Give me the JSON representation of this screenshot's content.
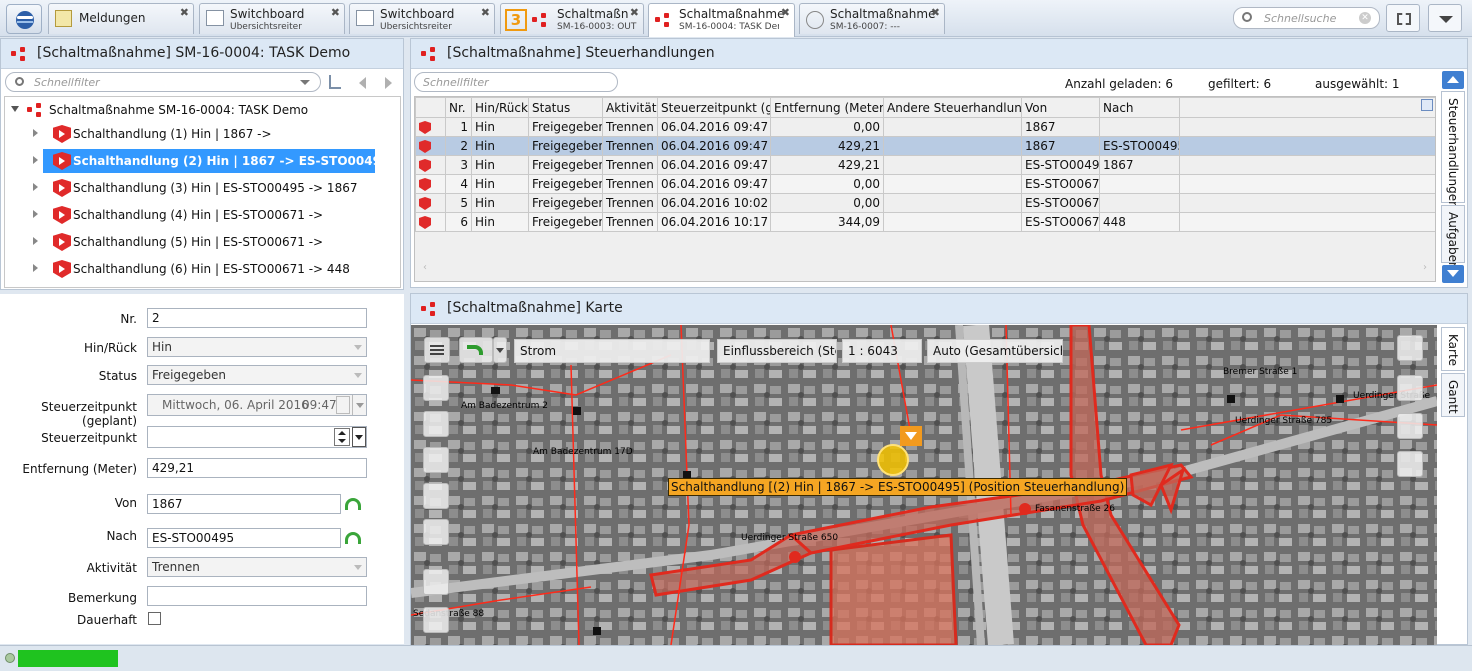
{
  "tabs": [
    {
      "title": "Meldungen",
      "subtitle": ""
    },
    {
      "title": "Switchboard",
      "subtitle": "Übersichtsreiter"
    },
    {
      "title": "Switchboard",
      "subtitle": "Übersichtsreiter"
    },
    {
      "title": "Schaltmaßnah",
      "subtitle": "SM-16-0003: OUT"
    },
    {
      "title": "Schaltmaßnahme",
      "subtitle": "SM-16-0004: TASK Demo"
    },
    {
      "title": "Schaltmaßnahme",
      "subtitle": "SM-16-0007: ---"
    }
  ],
  "tab_badge": "3",
  "search_placeholder": "Schnellsuche",
  "left_panel": {
    "title": "[Schaltmaßnahme] SM-16-0004: TASK Demo",
    "filter_placeholder": "Schnellfilter"
  },
  "tree": {
    "root": "Schaltmaßnahme SM-16-0004: TASK Demo",
    "items": [
      "Schalthandlung (1) Hin | 1867 ->",
      "Schalthandlung (2) Hin | 1867 -> ES-STO00495",
      "Schalthandlung (3) Hin | ES-STO00495 -> 1867",
      "Schalthandlung (4) Hin | ES-STO00671 ->",
      "Schalthandlung (5) Hin | ES-STO00671 ->",
      "Schalthandlung (6) Hin | ES-STO00671 -> 448"
    ]
  },
  "form": {
    "nr_label": "Nr.",
    "nr": "2",
    "hinrueck_label": "Hin/Rück",
    "hinrueck": "Hin",
    "status_label": "Status",
    "status": "Freigegeben",
    "geplant_label": "Steuerzeitpunkt (geplant)",
    "geplant_date": "Mittwoch, 06. April 2016",
    "geplant_time": "09:47",
    "steuerzeit_label": "Steuerzeitpunkt",
    "steuerzeit": "",
    "entfernung_label": "Entfernung (Meter)",
    "entfernung": "429,21",
    "von_label": "Von",
    "von": "1867",
    "nach_label": "Nach",
    "nach": "ES-STO00495",
    "aktivitaet_label": "Aktivität",
    "aktivitaet": "Trennen",
    "bemerkung_label": "Bemerkung",
    "bemerkung": "",
    "dauerhaft_label": "Dauerhaft"
  },
  "grid_panel": {
    "title": "[Schaltmaßnahme] Steuerhandlungen",
    "filter_placeholder": "Schnellfilter",
    "geladen": "Anzahl geladen: 6",
    "gefiltert": "gefiltert: 6",
    "ausgewaehlt": "ausgewählt: 1",
    "columns": [
      "",
      "Nr.",
      "Hin/Rück",
      "Status",
      "Aktivität",
      "Steuerzeitpunkt (ge",
      "Entfernung (Meter)",
      "Andere Steuerhandlung",
      "Von",
      "Nach"
    ],
    "rows": [
      [
        "1",
        "Hin",
        "Freigegeben",
        "Trennen",
        "06.04.2016 09:47",
        "0,00",
        "",
        "1867",
        ""
      ],
      [
        "2",
        "Hin",
        "Freigegeben",
        "Trennen",
        "06.04.2016 09:47",
        "429,21",
        "",
        "1867",
        "ES-STO00495"
      ],
      [
        "3",
        "Hin",
        "Freigegeben",
        "Trennen",
        "06.04.2016 09:47",
        "429,21",
        "",
        "ES-STO00495",
        "1867"
      ],
      [
        "4",
        "Hin",
        "Freigegeben",
        "Trennen",
        "06.04.2016 09:47",
        "0,00",
        "",
        "ES-STO00671",
        ""
      ],
      [
        "5",
        "Hin",
        "Freigegeben",
        "Trennen",
        "06.04.2016 10:02",
        "0,00",
        "",
        "ES-STO00671",
        ""
      ],
      [
        "6",
        "Hin",
        "Freigegeben",
        "Trennen",
        "06.04.2016 10:17",
        "344,09",
        "",
        "ES-STO00671",
        "448"
      ]
    ],
    "side_tabs": [
      "Steuerhandlungen",
      "Aufgaben"
    ]
  },
  "map_panel": {
    "title": "[Schaltmaßnahme] Karte",
    "layer": "Strom",
    "einfluss": "Einflussbereich (Steue",
    "scale": "1 : 6043",
    "auto": "Auto (Gesamtübersicht)",
    "callout": "Schalthandlung [(2) Hin | 1867 -> ES-STO00495] (Position Steuerhandlung)",
    "side_tabs": [
      "Karte",
      "Gantt"
    ],
    "labels": [
      "Am Badezentrum 2",
      "Am Badezentrum 17D",
      "Uerdinger Straße 650",
      "Fasanenstraße 26",
      "Bremer Straße 1",
      "Uerdinger Straße 785",
      "Uerdinger Straße",
      "Sedanstraße 88"
    ]
  },
  "colors": {
    "selection": "#3399ff",
    "grid_selection": "#b8cbe3",
    "network": "#e02020",
    "callout": "#f5a623",
    "progress": "#1fc31f"
  }
}
